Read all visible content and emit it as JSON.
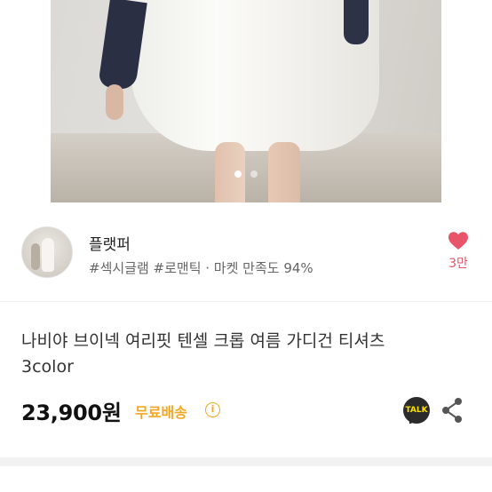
{
  "gallery": {
    "total_slides": 2,
    "active_index": 0
  },
  "shop": {
    "name": "플랫퍼",
    "tags": "#섹시글램 #로맨틱 · 마켓 만족도 94%",
    "likes": "3만"
  },
  "product": {
    "title_line1": "나비야 브이넥 여리핏 텐셀 크롭 여름 가디건 티셔츠",
    "title_line2": "3color",
    "price": "23,900원",
    "shipping": "무료배송",
    "info_symbol": "i",
    "talk_label": "TALK"
  },
  "colors": {
    "heart": "#e8546a",
    "shipping": "#f4a722",
    "talk_bg": "#2b2b2b",
    "talk_text": "#f9e000"
  }
}
